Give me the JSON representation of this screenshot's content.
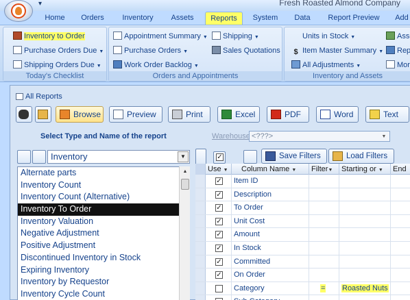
{
  "window": {
    "company": "Fresh Roasted Almond Company"
  },
  "tabs": [
    "Home",
    "Orders",
    "Inventory",
    "Assets",
    "Reports",
    "System",
    "Data",
    "Report Preview",
    "Add"
  ],
  "active_tab": "Reports",
  "ribbon": {
    "checklist": {
      "label": "Today's Checklist",
      "items": [
        "Inventory to Order",
        "Purchase Orders Due",
        "Shipping Orders Due"
      ]
    },
    "orders_appointments": {
      "label": "Orders and Appointments",
      "items": [
        "Appointment Summary",
        "Purchase Orders",
        "Work Order Backlog",
        "Shipping",
        "Sales Quotations"
      ]
    },
    "inventory_assets": {
      "label": "Inventory and Assets",
      "items": [
        "Units in Stock",
        "Item Master Summary",
        "All Adjustments",
        "Asse",
        "Rep",
        "Mor"
      ]
    }
  },
  "all_reports": {
    "title": "All Reports",
    "toolbar": [
      "Browse",
      "Preview",
      "Print",
      "Excel",
      "PDF",
      "Word",
      "Text"
    ],
    "select_label": "Select Type and Name of the report",
    "warehouse_label": "Warehouse:",
    "warehouse_value": "<???>",
    "type_value": "Inventory",
    "reports": [
      "Alternate parts",
      "Inventory Count",
      "Inventory Count (Alternative)",
      "Inventory To Order",
      "Inventory Valuation",
      "Negative Adjustment",
      "Positive Adjustment",
      "Discontinued Inventory in Stock",
      "Expiring Inventory",
      "Inventory by Requestor",
      "Inventory Cycle Count"
    ],
    "selected_report": "Inventory To Order",
    "filter_buttons": {
      "save": "Save Filters",
      "load": "Load Filters"
    },
    "grid": {
      "columns": [
        "Use",
        "Column Name",
        "Filter",
        "Starting or",
        "End"
      ],
      "rows": [
        {
          "use": true,
          "name": "Item ID",
          "filter": "",
          "start": ""
        },
        {
          "use": true,
          "name": "Description",
          "filter": "",
          "start": ""
        },
        {
          "use": true,
          "name": "To Order",
          "filter": "",
          "start": ""
        },
        {
          "use": true,
          "name": "Unit Cost",
          "filter": "",
          "start": ""
        },
        {
          "use": true,
          "name": "Amount",
          "filter": "",
          "start": ""
        },
        {
          "use": true,
          "name": "In Stock",
          "filter": "",
          "start": ""
        },
        {
          "use": true,
          "name": "Committed",
          "filter": "",
          "start": ""
        },
        {
          "use": true,
          "name": "On Order",
          "filter": "",
          "start": ""
        },
        {
          "use": false,
          "name": "Category",
          "filter": "=",
          "start": "Roasted Nuts"
        },
        {
          "use": false,
          "name": "Sub Category",
          "filter": "",
          "start": ""
        }
      ]
    }
  },
  "colors": {
    "highlight": "#ffff66",
    "selection": "#111111",
    "ribbon_text": "#15428b"
  }
}
